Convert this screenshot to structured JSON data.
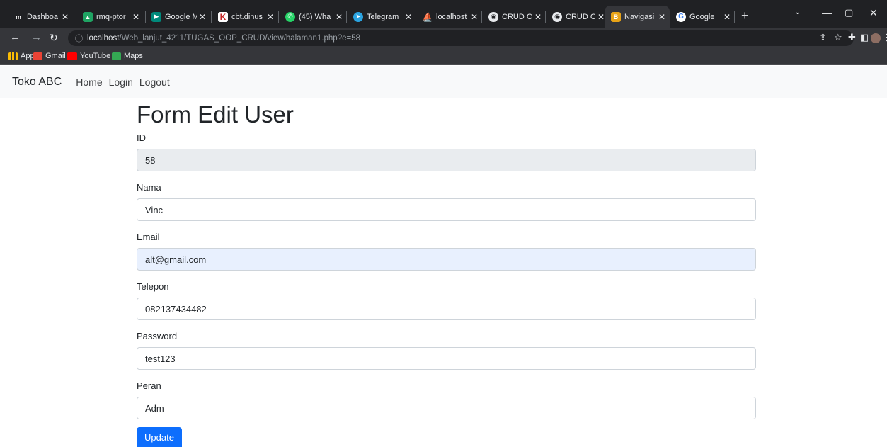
{
  "browser": {
    "tabs": [
      {
        "title": "Dashboa",
        "icon": "m",
        "color": "#202124"
      },
      {
        "title": "rmq-ptor",
        "icon": "drive",
        "color": "#1fa463"
      },
      {
        "title": "Google M",
        "icon": "meet",
        "color": "#00897b"
      },
      {
        "title": "cbt.dinus",
        "icon": "K",
        "color": "#c62828"
      },
      {
        "title": "(45) Wha",
        "icon": "whatsapp",
        "color": "#25d366"
      },
      {
        "title": "Telegram",
        "icon": "telegram",
        "color": "#2aa3e0"
      },
      {
        "title": "localhost",
        "icon": "phpmyadmin",
        "color": "#f0a500"
      },
      {
        "title": "CRUD Co",
        "icon": "globe",
        "color": "#5f6368"
      },
      {
        "title": "CRUD Co",
        "icon": "globe",
        "color": "#5f6368"
      },
      {
        "title": "Navigasi",
        "icon": "bootstrap",
        "color": "#e8a317"
      },
      {
        "title": "Google",
        "icon": "G",
        "color": "#4285f4"
      }
    ],
    "url_host": "localhost",
    "url_path": "/Web_lanjut_4211/TUGAS_OOP_CRUD/view/halaman1.php?e=58",
    "bookmarks": [
      {
        "label": "Apps",
        "color": "#fbbc04"
      },
      {
        "label": "Gmail",
        "color": "#ea4335"
      },
      {
        "label": "YouTube",
        "color": "#ff0000"
      },
      {
        "label": "Maps",
        "color": "#34a853"
      }
    ]
  },
  "navbar": {
    "brand": "Toko ABC",
    "links": [
      "Home",
      "Login",
      "Logout"
    ]
  },
  "form": {
    "title": "Form Edit User",
    "fields": [
      {
        "label": "ID",
        "value": "58",
        "state": "readonly"
      },
      {
        "label": "Nama",
        "value": "Vinc",
        "state": "normal"
      },
      {
        "label": "Email",
        "value": "alt@gmail.com",
        "state": "autofill"
      },
      {
        "label": "Telepon",
        "value": "082137434482",
        "state": "normal"
      },
      {
        "label": "Password",
        "value": "test123",
        "state": "normal"
      },
      {
        "label": "Peran",
        "value": "Adm",
        "state": "normal"
      }
    ],
    "submit_label": "Update"
  }
}
